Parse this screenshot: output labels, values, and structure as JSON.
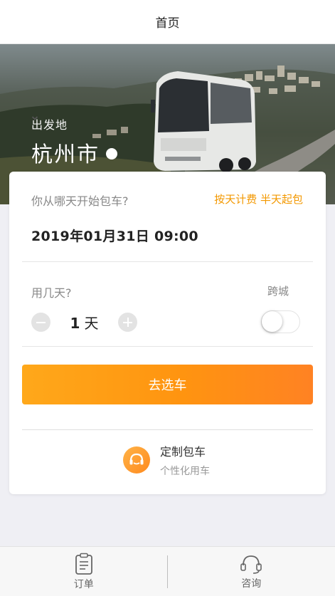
{
  "nav": {
    "title": "首页"
  },
  "hero": {
    "origin_label": "出发地",
    "city": "杭州市"
  },
  "booking": {
    "start_question": "你从哪天开始包车?",
    "pricing_tip": "按天计费 半天起包",
    "start_datetime": "2019年01月31日 09:00",
    "days_question": "用几天?",
    "days_value": "1",
    "days_unit": "天",
    "cross_city_label": "跨城",
    "cross_city_enabled": false,
    "submit_label": "去选车"
  },
  "custom_charter": {
    "title": "定制包车",
    "subtitle": "个性化用车"
  },
  "tabbar": {
    "items": [
      {
        "label": "订单",
        "icon": "order-icon"
      },
      {
        "label": "咨询",
        "icon": "headset-icon"
      }
    ]
  },
  "colors": {
    "accent_orange": "#ff9410",
    "tip_orange": "#f39800",
    "stepper_gray": "#e3e3e3"
  }
}
